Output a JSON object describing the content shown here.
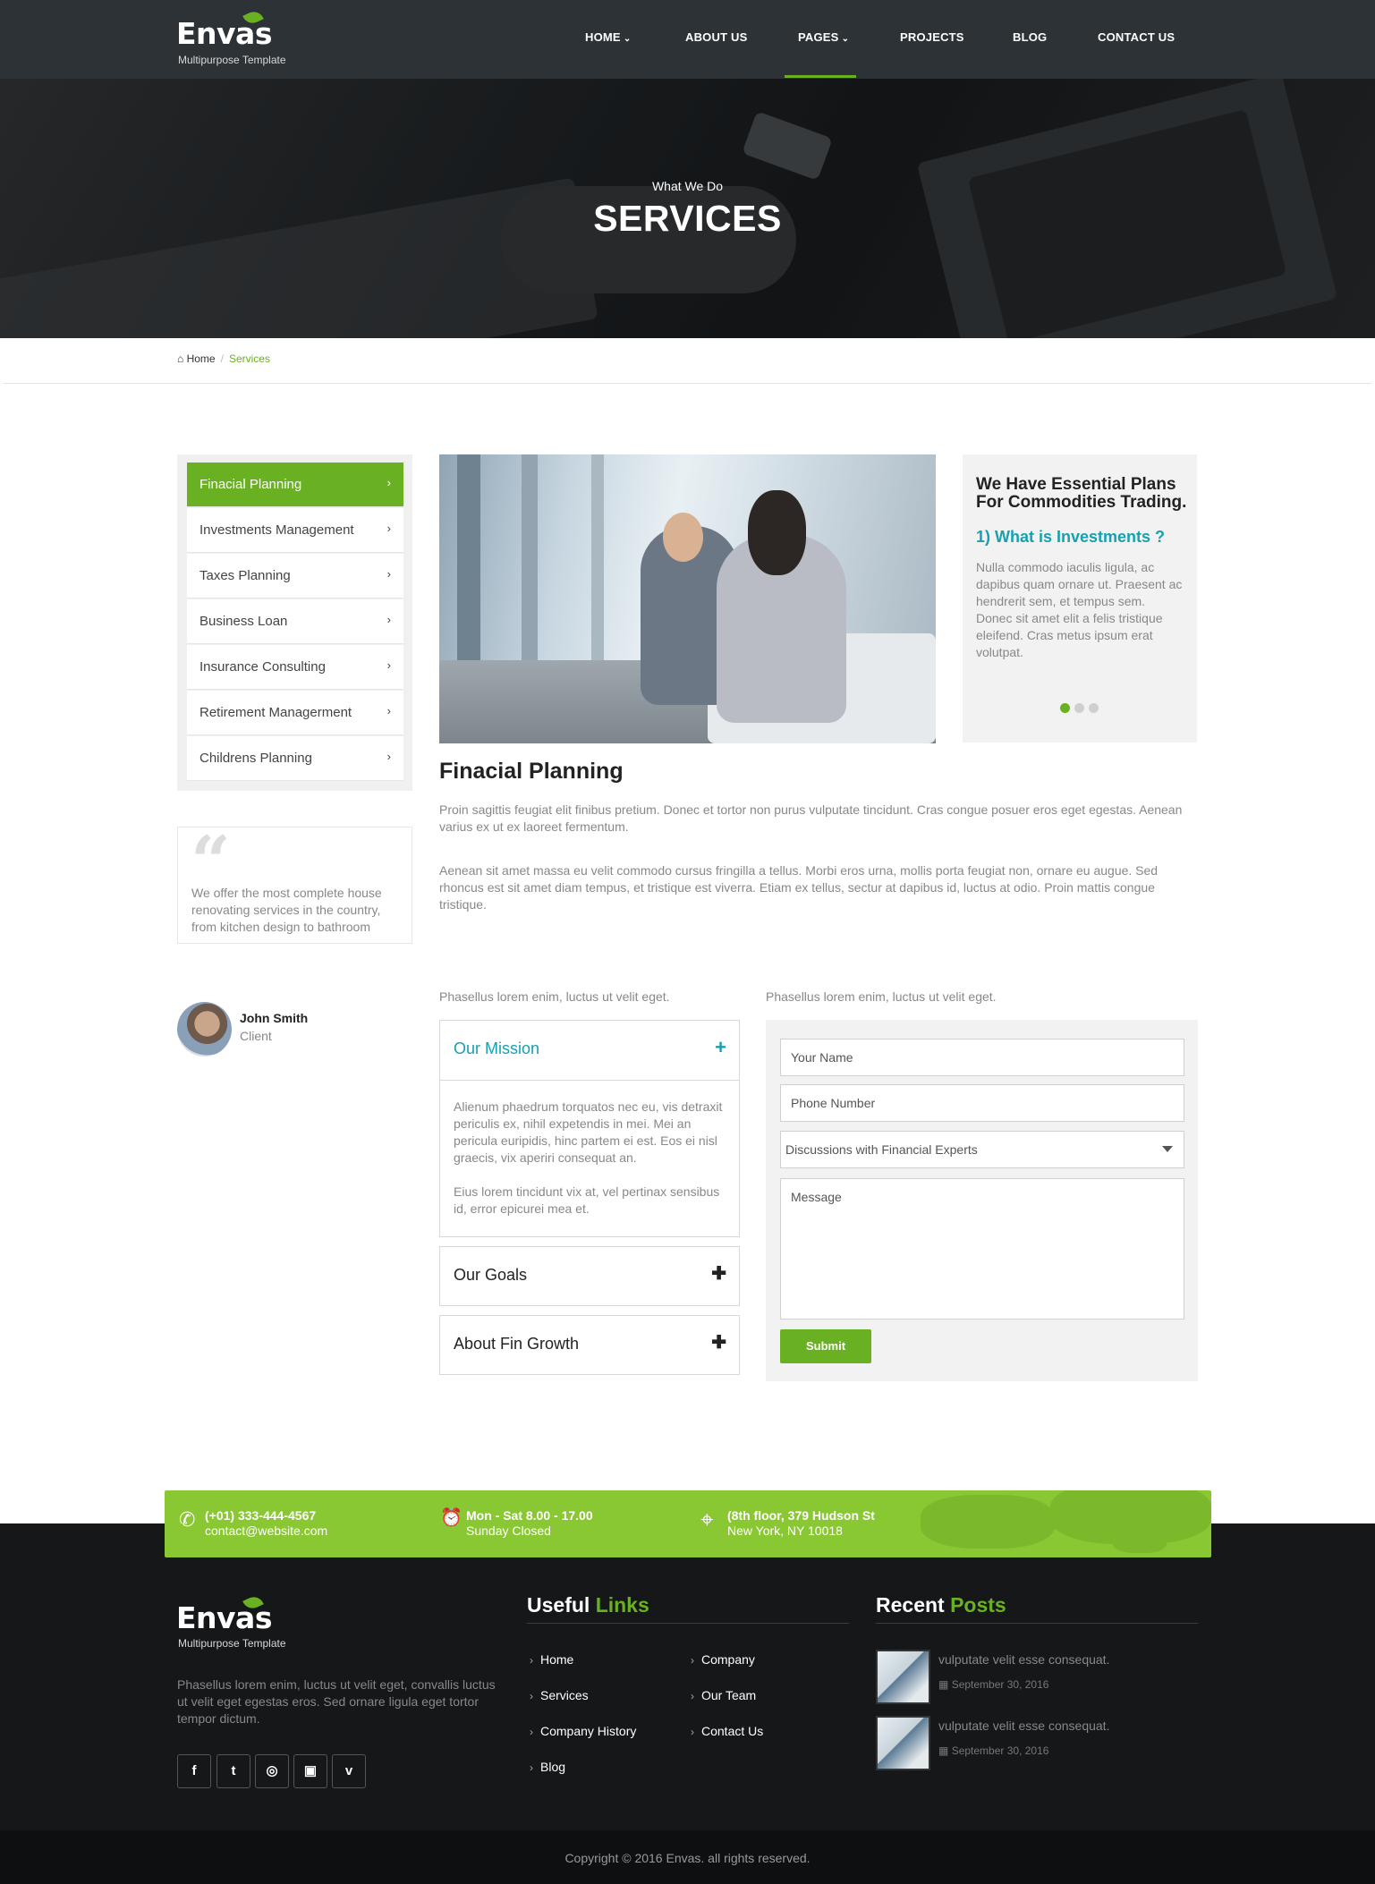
{
  "brand": {
    "name": "Envas",
    "tagline": "Multipurpose Template"
  },
  "nav": {
    "items": [
      {
        "label": "HOME",
        "has_dropdown": true
      },
      {
        "label": "ABOUT US",
        "has_dropdown": false
      },
      {
        "label": "PAGES",
        "has_dropdown": true,
        "active": true
      },
      {
        "label": "PROJECTS",
        "has_dropdown": false
      },
      {
        "label": "BLOG",
        "has_dropdown": false
      },
      {
        "label": "CONTACT US",
        "has_dropdown": false
      }
    ]
  },
  "hero": {
    "subtitle": "What We Do",
    "title": "SERVICES"
  },
  "breadcrumb": {
    "home": "Home",
    "separator": "/",
    "current": "Services"
  },
  "sidebar": {
    "items": [
      {
        "label": "Finacial Planning",
        "active": true
      },
      {
        "label": "Investments Management"
      },
      {
        "label": "Taxes Planning"
      },
      {
        "label": "Business Loan"
      },
      {
        "label": "Insurance Consulting"
      },
      {
        "label": "Retirement Managerment"
      },
      {
        "label": "Childrens Planning"
      }
    ],
    "chevron": "›"
  },
  "testimonial": {
    "quote_mark": "“",
    "text": "We offer the most complete house renovating services in the country, from kitchen design to bathroom",
    "name": "John Smith",
    "role": "Client"
  },
  "info_card": {
    "title": "We Have Essential Plans For Commodities Trading.",
    "question": "1) What is Investments ?",
    "text": "Nulla commodo iaculis ligula, ac dapibus quam ornare ut. Praesent ac hendrerit sem, et tempus sem. Donec sit amet elit a felis tristique eleifend. Cras metus ipsum erat volutpat.",
    "slides": 3,
    "active_slide": 1
  },
  "main": {
    "title": "Finacial Planning",
    "para1": "Proin sagittis feugiat elit finibus pretium. Donec et tortor non purus vulputate tincidunt. Cras congue posuer eros eget egestas. Aenean varius ex ut ex laoreet fermentum.",
    "para2": "Aenean sit amet massa eu velit commodo cursus fringilla a tellus. Morbi eros urna, mollis porta feugiat non, ornare eu augue. Sed rhoncus est sit amet diam tempus, et tristique est viverra. Etiam ex tellus, sectur at dapibus id, luctus at odio. Proin mattis congue tristique.",
    "cut_text": "Phasellus lorem enim, luctus ut velit eget."
  },
  "accordion": {
    "items": [
      {
        "title": "Our Mission",
        "open": true
      },
      {
        "title": "Our Goals",
        "open": false
      },
      {
        "title": "About Fin Growth",
        "open": false
      }
    ],
    "open_icon": "+",
    "closed_icon": "✚",
    "body_p1": "Alienum phaedrum torquatos nec eu, vis detraxit periculis ex, nihil expetendis in mei. Mei an pericula euripidis, hinc partem ei est. Eos ei nisl graecis, vix aperiri consequat an.",
    "body_p2": "Eius lorem tincidunt vix at, vel pertinax sensibus id, error epicurei mea et."
  },
  "form": {
    "name_placeholder": "Your Name",
    "phone_placeholder": "Phone Number",
    "select_value": "Discussions with Financial Experts",
    "message_placeholder": "Message",
    "submit_label": "Submit"
  },
  "contact_strip": {
    "phone": "(+01) 333-444-4567",
    "email": "contact@website.com",
    "hours_1": "Mon - Sat 8.00 - 17.00",
    "hours_2": "Sunday Closed",
    "address_1": "(8th floor, 379 Hudson St",
    "address_2": "New York, NY 10018",
    "phone_icon": "✆",
    "clock_icon": "⏰",
    "pin_icon": "⌖"
  },
  "footer": {
    "about": "Phasellus lorem enim, luctus ut velit eget, convallis luctus ut velit eget egestas eros. Sed ornare ligula eget tortor tempor dictum.",
    "social": [
      "f",
      "t",
      "◎",
      "▣",
      "v"
    ],
    "useful_links_title_1": "Useful",
    "useful_links_title_2": "Links",
    "links_col1": [
      "Home",
      "Services",
      "Company History",
      "Blog"
    ],
    "links_col2": [
      "Company",
      "Our Team",
      "Contact Us"
    ],
    "link_chevron": "›",
    "recent_title_1": "Recent",
    "recent_title_2": "Posts",
    "posts": [
      {
        "title": "vulputate velit esse consequat.",
        "date": "September 30, 2016"
      },
      {
        "title": "vulputate velit esse consequat.",
        "date": "September 30, 2016"
      }
    ],
    "calendar_icon": "▦",
    "copyright": "Copyright © 2016 Envas. all rights reserved."
  },
  "colors": {
    "accent": "#6ab023",
    "teal": "#15a1b1",
    "header_bg": "#2d3236",
    "footer_bg": "#151719",
    "strip_bg": "#8ac833"
  }
}
